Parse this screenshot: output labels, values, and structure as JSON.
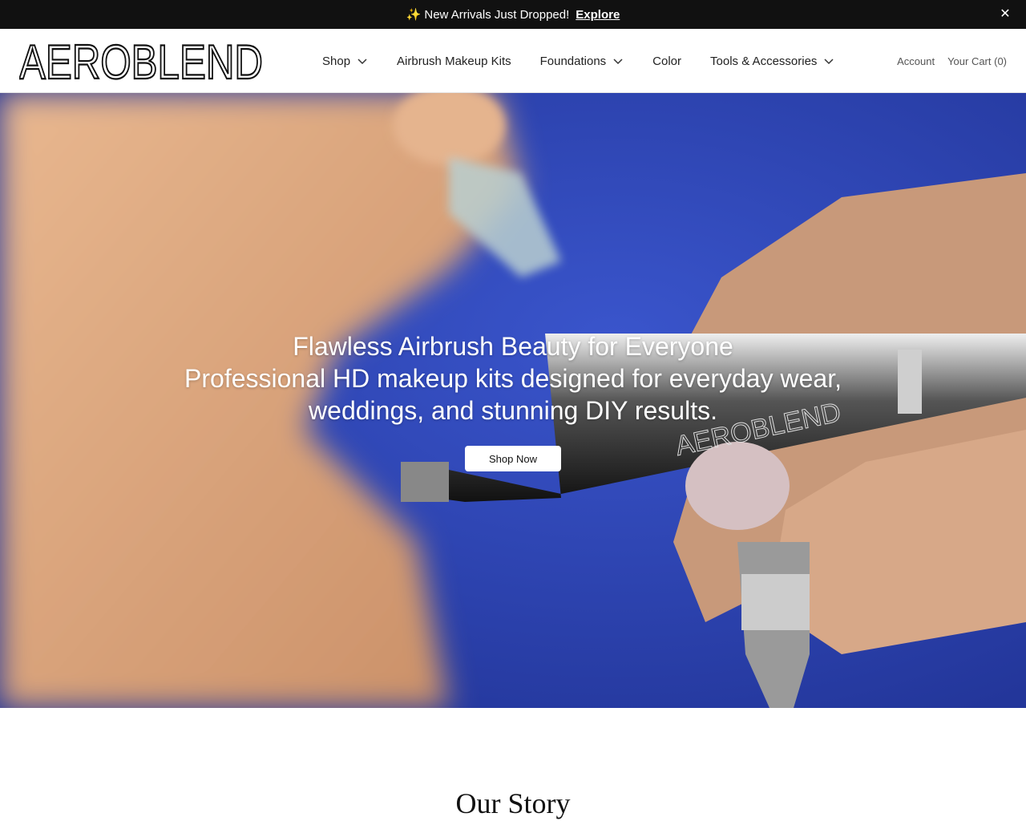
{
  "announcement": {
    "sparkle_icon": "sparkles-icon",
    "text": "New Arrivals Just Dropped!",
    "link_label": "Explore",
    "close_icon": "close-icon"
  },
  "header": {
    "logo_text": "AEROBLEND",
    "nav": [
      {
        "label": "Shop",
        "has_dropdown": true
      },
      {
        "label": "Airbrush Makeup Kits",
        "has_dropdown": false
      },
      {
        "label": "Foundations",
        "has_dropdown": true
      },
      {
        "label": "Color",
        "has_dropdown": false
      },
      {
        "label": "Tools & Accessories",
        "has_dropdown": true
      }
    ],
    "account_label": "Account",
    "cart_label": "Your Cart (0)"
  },
  "hero": {
    "title": "Flawless Airbrush Beauty for Everyone",
    "subtitle": "Professional HD makeup kits designed for everyday wear, weddings, and stunning DIY results.",
    "cta_label": "Shop Now",
    "product_engraving": "AEROBLEND",
    "background_color": "#2d44b8"
  },
  "story": {
    "heading": "Our Story"
  },
  "colors": {
    "announcement_bg": "#111111",
    "text_dark": "#111111",
    "hero_blue": "#2d44b8"
  }
}
